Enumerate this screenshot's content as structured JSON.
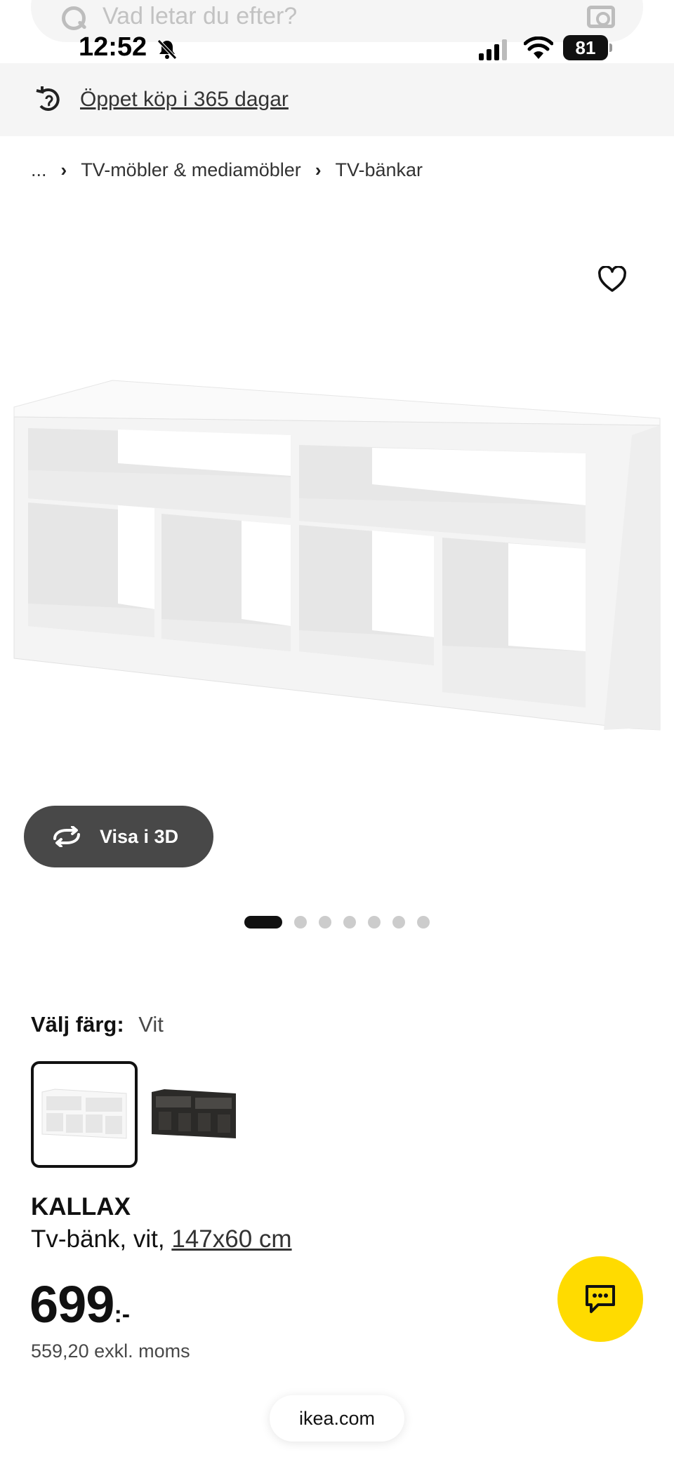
{
  "search": {
    "placeholder": "Vad letar du efter?"
  },
  "status_bar": {
    "time": "12:52",
    "battery": "81"
  },
  "promo": {
    "text": "Öppet köp i 365 dagar"
  },
  "breadcrumb": {
    "ellipsis": "...",
    "items": [
      "TV-möbler & mediamöbler",
      "TV-bänkar"
    ]
  },
  "product": {
    "view3d_label": "Visa i 3D",
    "carousel": {
      "count": 7,
      "active": 0
    },
    "color": {
      "label": "Välj färg:",
      "value": "Vit"
    },
    "swatches": [
      "white",
      "black-brown"
    ],
    "name": "KALLAX",
    "description": "Tv-bänk, vit,",
    "size_link": "147x60 cm",
    "price": {
      "amount": "699",
      "suffix": ":-",
      "ex_vat": "559,20 exkl. moms"
    }
  },
  "browser": {
    "url": "ikea.com"
  },
  "colors": {
    "accent_yellow": "#ffdb00",
    "button_dark": "#484848",
    "page_bg": "#ffffff"
  }
}
